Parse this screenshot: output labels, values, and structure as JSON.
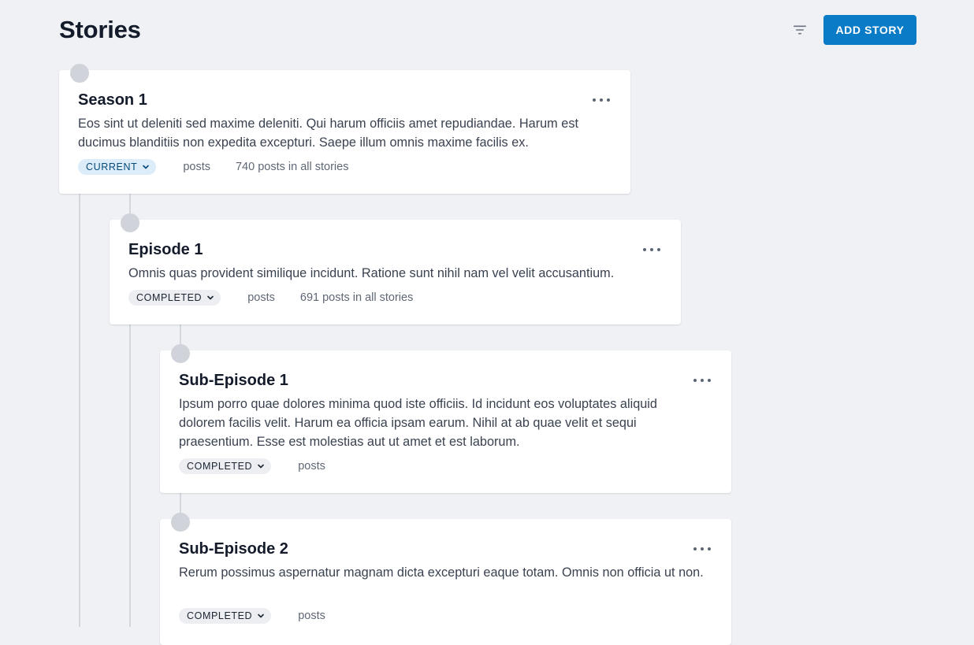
{
  "header": {
    "title": "Stories",
    "add_button_label": "ADD STORY"
  },
  "stories": [
    {
      "title": "Season 1",
      "description": "Eos sint ut deleniti sed maxime deleniti. Qui harum officiis amet repudiandae. Harum est ducimus blanditiis non expedita excepturi. Saepe illum omnis maxime facilis ex.",
      "status": "CURRENT",
      "posts_label": "posts",
      "total_label": "740 posts in all stories"
    },
    {
      "title": "Episode 1",
      "description": "Omnis quas provident similique incidunt. Ratione sunt nihil nam vel velit accusantium.",
      "status": "COMPLETED",
      "posts_label": "posts",
      "total_label": "691 posts in all stories"
    },
    {
      "title": "Sub-Episode 1",
      "description": "Ipsum porro quae dolores minima quod iste officiis. Id incidunt eos voluptates aliquid dolorem facilis velit. Harum ea officia ipsam earum. Nihil at ab quae velit et sequi praesentium. Esse est molestias aut ut amet et est laborum.",
      "status": "COMPLETED",
      "posts_label": "posts"
    },
    {
      "title": "Sub-Episode 2",
      "description": "Rerum possimus aspernatur magnam dicta excepturi eaque totam. Omnis non officia ut non.",
      "status": "COMPLETED",
      "posts_label": "posts"
    }
  ],
  "colors": {
    "accent": "#0a7bc7",
    "background": "#eff1f4",
    "current_chip": "#dcecf8",
    "completed_chip": "#eceef1"
  }
}
